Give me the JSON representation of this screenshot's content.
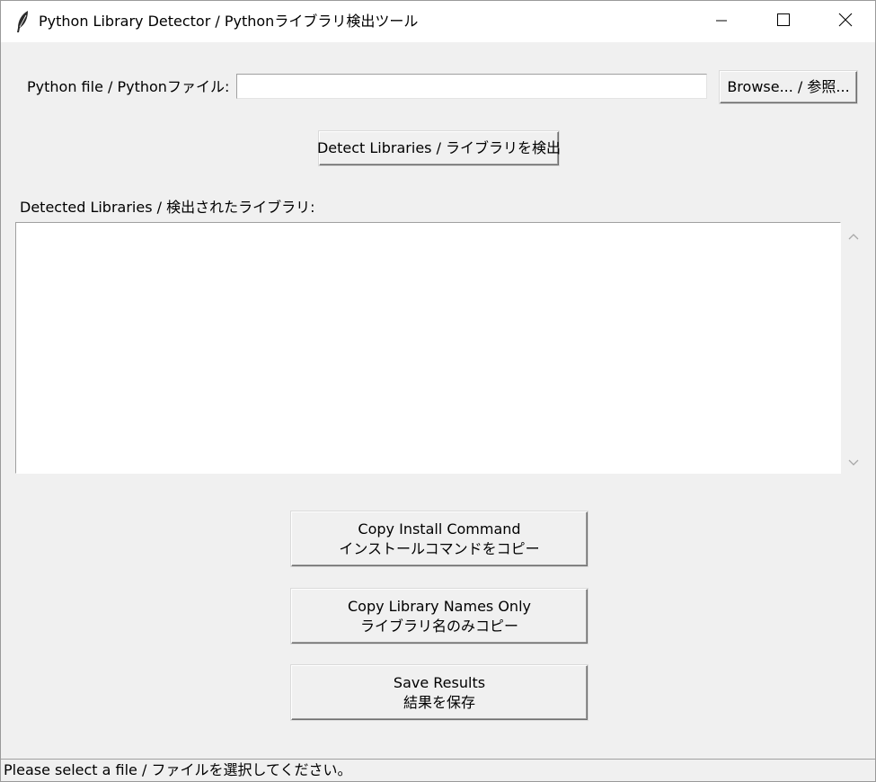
{
  "window": {
    "title": "Python Library Detector / Pythonライブラリ検出ツール",
    "icon": "feather-icon",
    "controls": [
      "minimize-icon",
      "maximize-icon",
      "close-icon"
    ]
  },
  "file_row": {
    "label": "Python file / Pythonファイル:",
    "input_value": "",
    "browse_label": "Browse... / 参照..."
  },
  "detect_button": {
    "label": "Detect Libraries / ライブラリを検出"
  },
  "results": {
    "label": "Detected Libraries / 検出されたライブラリ:",
    "content": ""
  },
  "actions": {
    "copy_install": {
      "line1": "Copy Install Command",
      "line2": "インストールコマンドをコピー"
    },
    "copy_names": {
      "line1": "Copy Library Names Only",
      "line2": "ライブラリ名のみコピー"
    },
    "save": {
      "line1": "Save Results",
      "line2": "結果を保存"
    }
  },
  "status": {
    "text": "Please select a file / ファイルを選択してください。"
  }
}
